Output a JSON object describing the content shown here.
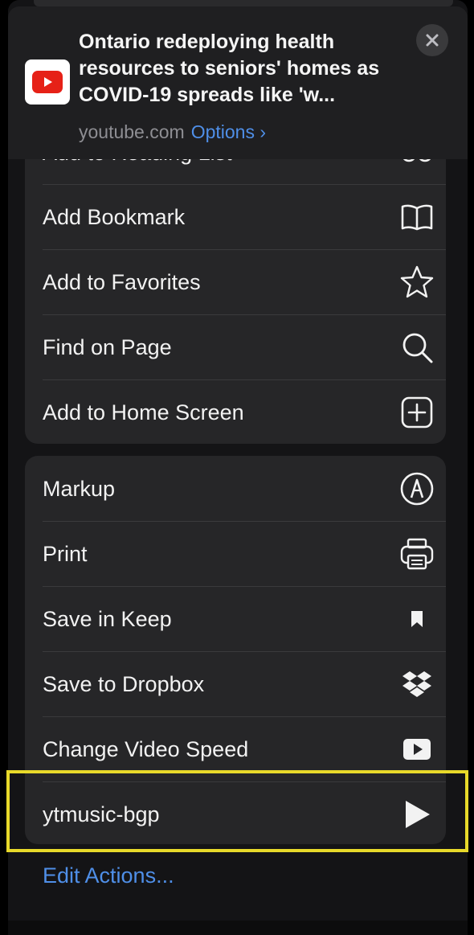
{
  "header": {
    "title": "Ontario redeploying health resources to seniors' homes as COVID-19 spreads like 'w...",
    "domain": "youtube.com",
    "options_label": "Options ›",
    "app_icon": "youtube-logo-icon",
    "close_icon": "close-icon"
  },
  "group1": {
    "partial_item": {
      "label": "Add to Reading List",
      "icon": "glasses-icon"
    },
    "items": [
      {
        "label": "Add Bookmark",
        "icon": "book-icon"
      },
      {
        "label": "Add to Favorites",
        "icon": "star-icon"
      },
      {
        "label": "Find on Page",
        "icon": "search-icon"
      },
      {
        "label": "Add to Home Screen",
        "icon": "plus-square-icon"
      }
    ]
  },
  "group2": {
    "items": [
      {
        "label": "Markup",
        "icon": "markup-pen-icon"
      },
      {
        "label": "Print",
        "icon": "printer-icon"
      },
      {
        "label": "Save in Keep",
        "icon": "bookmark-icon"
      },
      {
        "label": "Save to Dropbox",
        "icon": "dropbox-icon"
      },
      {
        "label": "Change Video Speed",
        "icon": "video-play-icon"
      },
      {
        "label": "ytmusic-bgp",
        "icon": "play-icon"
      }
    ]
  },
  "footer": {
    "edit_actions_label": "Edit Actions..."
  },
  "colors": {
    "accent": "#4f8fe8",
    "highlight": "#e8d92a",
    "youtube_red": "#e62117"
  }
}
